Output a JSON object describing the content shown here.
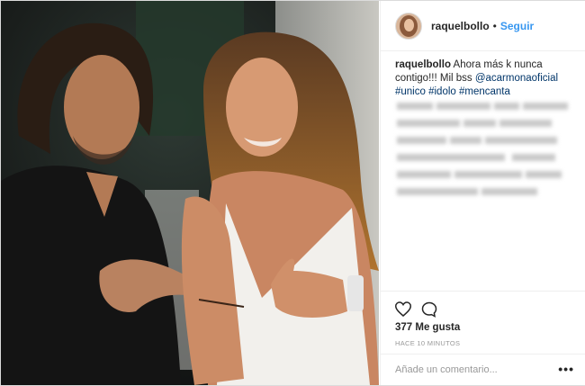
{
  "post": {
    "username": "raquelbollo",
    "separator": "•",
    "follow_label": "Seguir",
    "caption": {
      "username": "raquelbollo",
      "text": " Ahora más k nunca contigo!!! Mil bss ",
      "mention": "@acarmonaoficial",
      "tag1": "#unico",
      "tag2": "#idolo",
      "tag3": "#mencanta"
    },
    "likes": "377 Me gusta",
    "time": "HACE 10 MINUTOS",
    "comment_placeholder": "Añade un comentario...",
    "more_label": "•••"
  },
  "icons": {
    "like": "heart-icon",
    "comment": "comment-bubble-icon",
    "more": "more-options-icon"
  },
  "colors": {
    "link": "#3897f0",
    "hashtag": "#003569",
    "muted": "#999999"
  }
}
